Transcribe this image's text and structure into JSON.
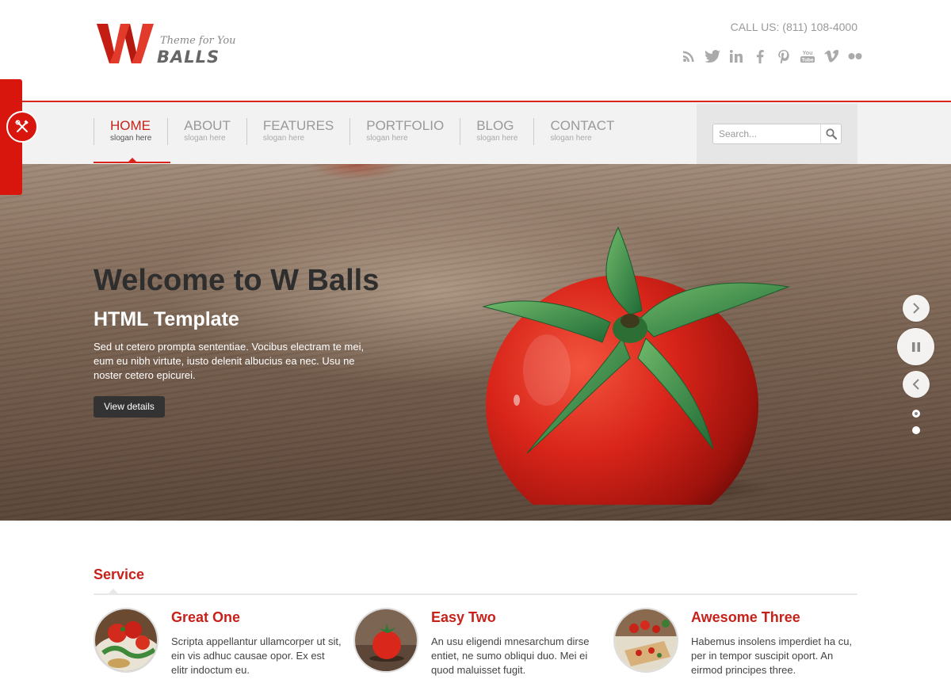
{
  "brand": {
    "logo_letter": "W",
    "tagline": "Theme for You",
    "name": "BALLS",
    "accent_color": "#d9261c"
  },
  "header": {
    "call_us": "CALL US: (811) 108-4000",
    "social": [
      "rss-icon",
      "twitter-icon",
      "linkedin-icon",
      "facebook-icon",
      "pinterest-icon",
      "youtube-icon",
      "vimeo-icon",
      "flickr-icon"
    ]
  },
  "nav": {
    "items": [
      {
        "label": "HOME",
        "slogan": "slogan here",
        "active": true
      },
      {
        "label": "ABOUT",
        "slogan": "slogan here",
        "active": false
      },
      {
        "label": "FEATURES",
        "slogan": "slogan here",
        "active": false
      },
      {
        "label": "PORTFOLIO",
        "slogan": "slogan here",
        "active": false
      },
      {
        "label": "BLOG",
        "slogan": "slogan here",
        "active": false
      },
      {
        "label": "CONTACT",
        "slogan": "slogan here",
        "active": false
      }
    ],
    "search_placeholder": "Search..."
  },
  "hero": {
    "title": "Welcome to W Balls",
    "subtitle": "HTML Template",
    "text": "Sed ut cetero prompta sententiae. Vocibus electram te mei, eum eu nibh virtute, iusto delenit albucius ea nec. Usu ne noster cetero epicurei.",
    "button": "View details",
    "slides": 2,
    "active_slide": 1
  },
  "service": {
    "heading": "Service",
    "items": [
      {
        "title": "Great One",
        "text": "Scripta appellantur ullamcorper ut sit, ein vis adhuc causae opor. Ex est elitr indoctum eu."
      },
      {
        "title": "Easy Two",
        "text": "An usu eligendi mnesarchum dirse entiet, ne sumo obliqui duo. Mei ei quod maluisset fugit."
      },
      {
        "title": "Awesome Three",
        "text": "Habemus insolens imperdiet ha cu, per in tempor suscipit oport. An eirmod principes three."
      }
    ]
  }
}
